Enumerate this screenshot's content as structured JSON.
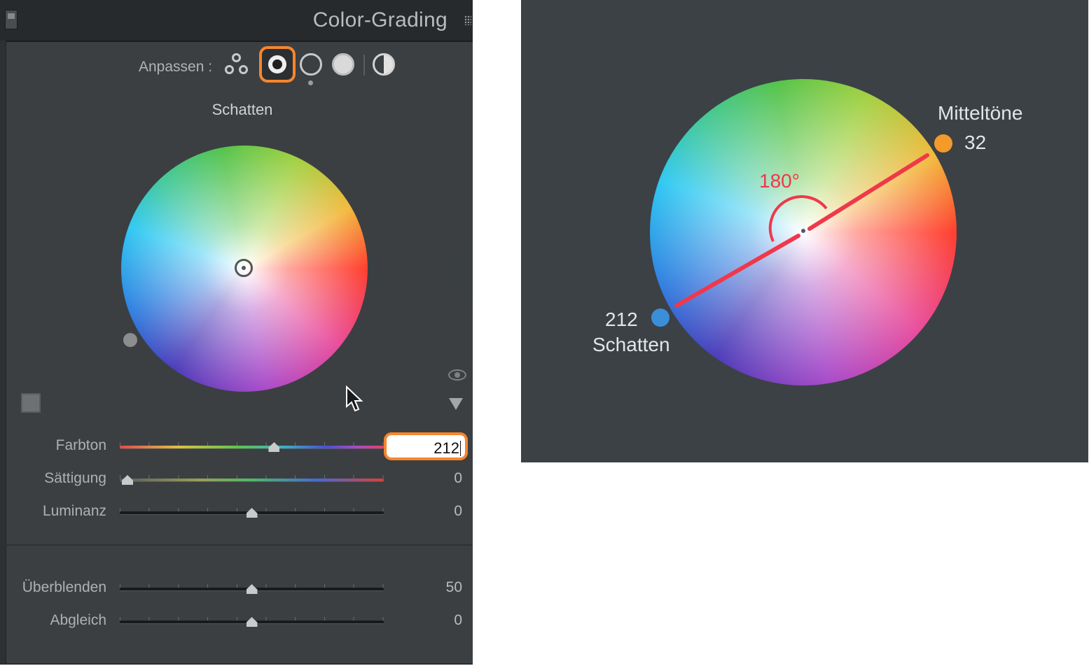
{
  "panel": {
    "title": "Color-Grading",
    "adjust_label": "Anpassen :",
    "modes": [
      "3-way-icon",
      "shadows-icon",
      "midtones-icon",
      "highlights-icon",
      "global-icon"
    ],
    "active_mode": "shadows",
    "section_label": "Schatten",
    "sliders": [
      {
        "label": "Farbton",
        "value": "212",
        "position": 0.59
      },
      {
        "label": "Sättigung",
        "value": "0",
        "position": 0.0
      },
      {
        "label": "Luminanz",
        "value": "0",
        "position": 0.5
      },
      {
        "label": "Überblenden",
        "value": "50",
        "position": 0.5
      },
      {
        "label": "Abgleich",
        "value": "0",
        "position": 0.5
      }
    ]
  },
  "illustration": {
    "midtones_label": "Mitteltöne",
    "midtones_value": "32",
    "shadows_value": "212",
    "shadows_label": "Schatten",
    "angle_label": "180°"
  },
  "colors": {
    "highlight": "#f7852c",
    "line": "#f0384a",
    "midtones_marker": "#f49a2a",
    "shadows_marker": "#3a8fd8"
  }
}
